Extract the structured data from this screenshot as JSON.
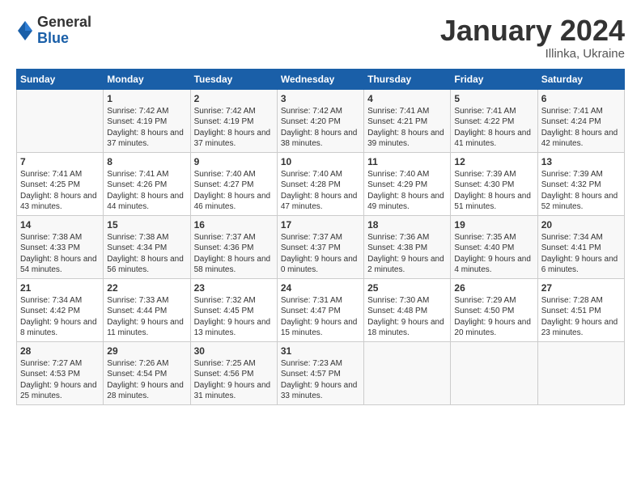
{
  "logo": {
    "general": "General",
    "blue": "Blue"
  },
  "title": "January 2024",
  "location": "Illinka, Ukraine",
  "days_header": [
    "Sunday",
    "Monday",
    "Tuesday",
    "Wednesday",
    "Thursday",
    "Friday",
    "Saturday"
  ],
  "weeks": [
    [
      {
        "num": "",
        "sunrise": "",
        "sunset": "",
        "daylight": ""
      },
      {
        "num": "1",
        "sunrise": "Sunrise: 7:42 AM",
        "sunset": "Sunset: 4:19 PM",
        "daylight": "Daylight: 8 hours and 37 minutes."
      },
      {
        "num": "2",
        "sunrise": "Sunrise: 7:42 AM",
        "sunset": "Sunset: 4:19 PM",
        "daylight": "Daylight: 8 hours and 37 minutes."
      },
      {
        "num": "3",
        "sunrise": "Sunrise: 7:42 AM",
        "sunset": "Sunset: 4:20 PM",
        "daylight": "Daylight: 8 hours and 38 minutes."
      },
      {
        "num": "4",
        "sunrise": "Sunrise: 7:41 AM",
        "sunset": "Sunset: 4:21 PM",
        "daylight": "Daylight: 8 hours and 39 minutes."
      },
      {
        "num": "5",
        "sunrise": "Sunrise: 7:41 AM",
        "sunset": "Sunset: 4:22 PM",
        "daylight": "Daylight: 8 hours and 41 minutes."
      },
      {
        "num": "6",
        "sunrise": "Sunrise: 7:41 AM",
        "sunset": "Sunset: 4:24 PM",
        "daylight": "Daylight: 8 hours and 42 minutes."
      }
    ],
    [
      {
        "num": "7",
        "sunrise": "Sunrise: 7:41 AM",
        "sunset": "Sunset: 4:25 PM",
        "daylight": "Daylight: 8 hours and 43 minutes."
      },
      {
        "num": "8",
        "sunrise": "Sunrise: 7:41 AM",
        "sunset": "Sunset: 4:26 PM",
        "daylight": "Daylight: 8 hours and 44 minutes."
      },
      {
        "num": "9",
        "sunrise": "Sunrise: 7:40 AM",
        "sunset": "Sunset: 4:27 PM",
        "daylight": "Daylight: 8 hours and 46 minutes."
      },
      {
        "num": "10",
        "sunrise": "Sunrise: 7:40 AM",
        "sunset": "Sunset: 4:28 PM",
        "daylight": "Daylight: 8 hours and 47 minutes."
      },
      {
        "num": "11",
        "sunrise": "Sunrise: 7:40 AM",
        "sunset": "Sunset: 4:29 PM",
        "daylight": "Daylight: 8 hours and 49 minutes."
      },
      {
        "num": "12",
        "sunrise": "Sunrise: 7:39 AM",
        "sunset": "Sunset: 4:30 PM",
        "daylight": "Daylight: 8 hours and 51 minutes."
      },
      {
        "num": "13",
        "sunrise": "Sunrise: 7:39 AM",
        "sunset": "Sunset: 4:32 PM",
        "daylight": "Daylight: 8 hours and 52 minutes."
      }
    ],
    [
      {
        "num": "14",
        "sunrise": "Sunrise: 7:38 AM",
        "sunset": "Sunset: 4:33 PM",
        "daylight": "Daylight: 8 hours and 54 minutes."
      },
      {
        "num": "15",
        "sunrise": "Sunrise: 7:38 AM",
        "sunset": "Sunset: 4:34 PM",
        "daylight": "Daylight: 8 hours and 56 minutes."
      },
      {
        "num": "16",
        "sunrise": "Sunrise: 7:37 AM",
        "sunset": "Sunset: 4:36 PM",
        "daylight": "Daylight: 8 hours and 58 minutes."
      },
      {
        "num": "17",
        "sunrise": "Sunrise: 7:37 AM",
        "sunset": "Sunset: 4:37 PM",
        "daylight": "Daylight: 9 hours and 0 minutes."
      },
      {
        "num": "18",
        "sunrise": "Sunrise: 7:36 AM",
        "sunset": "Sunset: 4:38 PM",
        "daylight": "Daylight: 9 hours and 2 minutes."
      },
      {
        "num": "19",
        "sunrise": "Sunrise: 7:35 AM",
        "sunset": "Sunset: 4:40 PM",
        "daylight": "Daylight: 9 hours and 4 minutes."
      },
      {
        "num": "20",
        "sunrise": "Sunrise: 7:34 AM",
        "sunset": "Sunset: 4:41 PM",
        "daylight": "Daylight: 9 hours and 6 minutes."
      }
    ],
    [
      {
        "num": "21",
        "sunrise": "Sunrise: 7:34 AM",
        "sunset": "Sunset: 4:42 PM",
        "daylight": "Daylight: 9 hours and 8 minutes."
      },
      {
        "num": "22",
        "sunrise": "Sunrise: 7:33 AM",
        "sunset": "Sunset: 4:44 PM",
        "daylight": "Daylight: 9 hours and 11 minutes."
      },
      {
        "num": "23",
        "sunrise": "Sunrise: 7:32 AM",
        "sunset": "Sunset: 4:45 PM",
        "daylight": "Daylight: 9 hours and 13 minutes."
      },
      {
        "num": "24",
        "sunrise": "Sunrise: 7:31 AM",
        "sunset": "Sunset: 4:47 PM",
        "daylight": "Daylight: 9 hours and 15 minutes."
      },
      {
        "num": "25",
        "sunrise": "Sunrise: 7:30 AM",
        "sunset": "Sunset: 4:48 PM",
        "daylight": "Daylight: 9 hours and 18 minutes."
      },
      {
        "num": "26",
        "sunrise": "Sunrise: 7:29 AM",
        "sunset": "Sunset: 4:50 PM",
        "daylight": "Daylight: 9 hours and 20 minutes."
      },
      {
        "num": "27",
        "sunrise": "Sunrise: 7:28 AM",
        "sunset": "Sunset: 4:51 PM",
        "daylight": "Daylight: 9 hours and 23 minutes."
      }
    ],
    [
      {
        "num": "28",
        "sunrise": "Sunrise: 7:27 AM",
        "sunset": "Sunset: 4:53 PM",
        "daylight": "Daylight: 9 hours and 25 minutes."
      },
      {
        "num": "29",
        "sunrise": "Sunrise: 7:26 AM",
        "sunset": "Sunset: 4:54 PM",
        "daylight": "Daylight: 9 hours and 28 minutes."
      },
      {
        "num": "30",
        "sunrise": "Sunrise: 7:25 AM",
        "sunset": "Sunset: 4:56 PM",
        "daylight": "Daylight: 9 hours and 31 minutes."
      },
      {
        "num": "31",
        "sunrise": "Sunrise: 7:23 AM",
        "sunset": "Sunset: 4:57 PM",
        "daylight": "Daylight: 9 hours and 33 minutes."
      },
      {
        "num": "",
        "sunrise": "",
        "sunset": "",
        "daylight": ""
      },
      {
        "num": "",
        "sunrise": "",
        "sunset": "",
        "daylight": ""
      },
      {
        "num": "",
        "sunrise": "",
        "sunset": "",
        "daylight": ""
      }
    ]
  ]
}
